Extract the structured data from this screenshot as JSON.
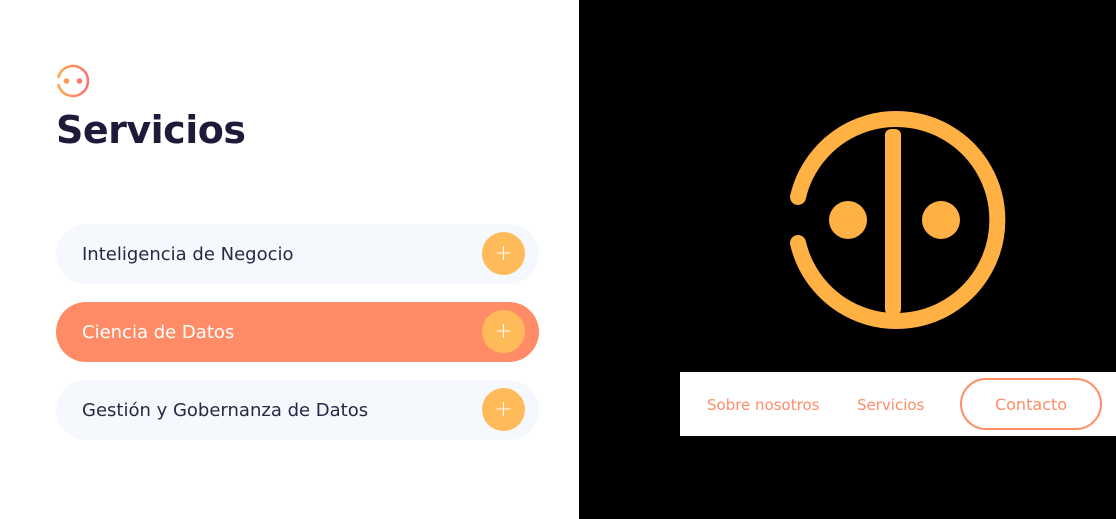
{
  "colors": {
    "accent": "#ff8c67",
    "plus": "#ffbb5a",
    "logo": "#ffb144",
    "title": "#1d1a3a",
    "item_bg": "#f5f8fc"
  },
  "left": {
    "title": "Servicios",
    "items": [
      {
        "label": "Inteligencia de Negocio",
        "icon": "plus-icon",
        "active": false
      },
      {
        "label": "Ciencia de Datos",
        "icon": "plus-icon",
        "active": true
      },
      {
        "label": "Gestión y Gobernanza de Datos",
        "icon": "plus-icon",
        "active": false
      }
    ]
  },
  "nav": {
    "about": "Sobre nosotros",
    "services": "Servicios",
    "contact": "Contacto"
  }
}
